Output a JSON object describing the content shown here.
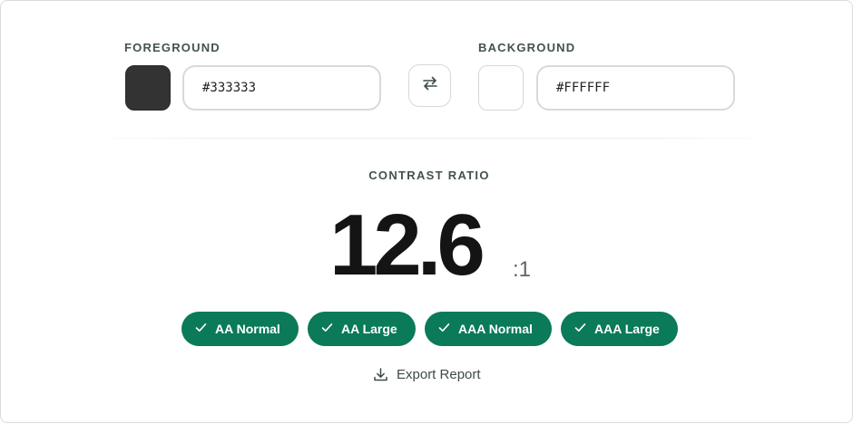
{
  "foreground": {
    "label": "FOREGROUND",
    "value": "#333333",
    "color": "#333333"
  },
  "background": {
    "label": "BACKGROUND",
    "value": "#FFFFFF",
    "color": "#ffffff"
  },
  "swap_icon": "swap-arrows-icon",
  "contrast": {
    "label": "CONTRAST RATIO",
    "value": "12.6",
    "suffix": ":1"
  },
  "badges": [
    {
      "label": "AA Normal",
      "icon": "check-icon"
    },
    {
      "label": "AA Large",
      "icon": "check-icon"
    },
    {
      "label": "AAA Normal",
      "icon": "check-icon"
    },
    {
      "label": "AAA Large",
      "icon": "check-icon"
    }
  ],
  "badge_color": "#0a7a59",
  "export": {
    "label": "Export Report",
    "icon": "download-icon"
  }
}
